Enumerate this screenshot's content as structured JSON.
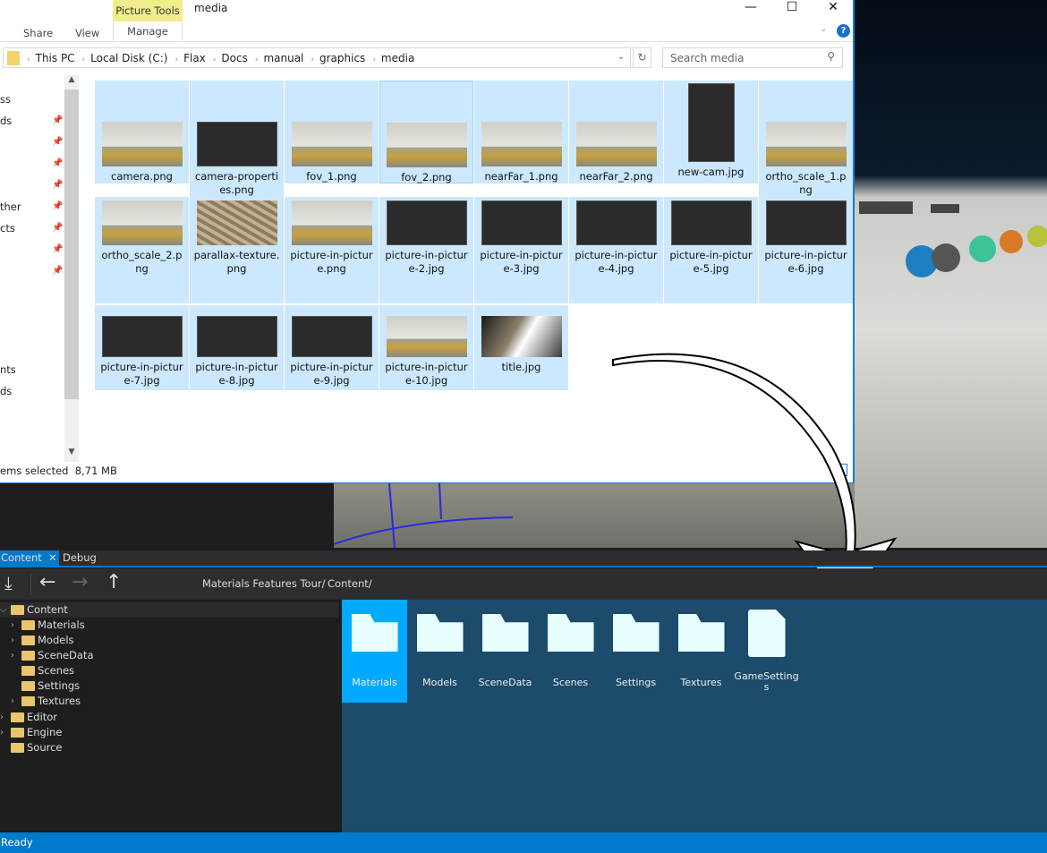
{
  "explorer": {
    "title": "media",
    "ribbon": {
      "share": "Share",
      "view": "View",
      "picture_tools": "Picture Tools",
      "manage": "Manage"
    },
    "window_controls": {
      "minimize": "—",
      "maximize": "☐",
      "close": "✕"
    },
    "breadcrumb": [
      "This PC",
      "Local Disk (C:)",
      "Flax",
      "Docs",
      "manual",
      "graphics",
      "media"
    ],
    "search_placeholder": "Search media",
    "nav_fragments": [
      "ss",
      "ds",
      "",
      "",
      "",
      "ther",
      "cts",
      "",
      "",
      "nts",
      "ds"
    ],
    "files": [
      {
        "name": "camera.png",
        "thumb": "light"
      },
      {
        "name": "camera-properties.png",
        "thumb": "dark"
      },
      {
        "name": "fov_1.png",
        "thumb": "light"
      },
      {
        "name": "fov_2.png",
        "thumb": "light"
      },
      {
        "name": "nearFar_1.png",
        "thumb": "light"
      },
      {
        "name": "nearFar_2.png",
        "thumb": "light"
      },
      {
        "name": "new-cam.jpg",
        "thumb": "dark"
      },
      {
        "name": "ortho_scale_1.png",
        "thumb": "light"
      },
      {
        "name": "ortho_scale_2.png",
        "thumb": "light"
      },
      {
        "name": "parallax-texture.png",
        "thumb": "texture"
      },
      {
        "name": "picture-in-picture.png",
        "thumb": "light"
      },
      {
        "name": "picture-in-picture-2.jpg",
        "thumb": "dark"
      },
      {
        "name": "picture-in-picture-3.jpg",
        "thumb": "dark"
      },
      {
        "name": "picture-in-picture-4.jpg",
        "thumb": "dark"
      },
      {
        "name": "picture-in-picture-5.jpg",
        "thumb": "dark"
      },
      {
        "name": "picture-in-picture-6.jpg",
        "thumb": "dark"
      },
      {
        "name": "picture-in-picture-7.jpg",
        "thumb": "dark"
      },
      {
        "name": "picture-in-picture-8.jpg",
        "thumb": "dark"
      },
      {
        "name": "picture-in-picture-9.jpg",
        "thumb": "dark"
      },
      {
        "name": "picture-in-picture-10.jpg",
        "thumb": "light"
      },
      {
        "name": "title.jpg",
        "thumb": "photo"
      }
    ],
    "status": {
      "selected": "ems selected",
      "size": "8,71 MB"
    }
  },
  "editor": {
    "tabs": [
      "Content",
      "Debug"
    ],
    "toolbar_path": [
      "Materials Features Tour/",
      "Content/"
    ],
    "tree": [
      {
        "label": "Content",
        "level": 0,
        "expanded": true
      },
      {
        "label": "Materials",
        "level": 1,
        "chevron": true
      },
      {
        "label": "Models",
        "level": 1,
        "chevron": true
      },
      {
        "label": "SceneData",
        "level": 1,
        "chevron": true
      },
      {
        "label": "Scenes",
        "level": 1,
        "chevron": false
      },
      {
        "label": "Settings",
        "level": 1,
        "chevron": false
      },
      {
        "label": "Textures",
        "level": 1,
        "chevron": true
      },
      {
        "label": "Editor",
        "level": 0,
        "chevron": true
      },
      {
        "label": "Engine",
        "level": 0,
        "chevron": true
      },
      {
        "label": "Source",
        "level": 0,
        "chevron": false
      }
    ],
    "items": [
      {
        "label": "Materials",
        "type": "folder",
        "selected": true
      },
      {
        "label": "Models",
        "type": "folder"
      },
      {
        "label": "SceneData",
        "type": "folder"
      },
      {
        "label": "Scenes",
        "type": "folder"
      },
      {
        "label": "Settings",
        "type": "folder"
      },
      {
        "label": "Textures",
        "type": "folder"
      },
      {
        "label": "GameSettings",
        "type": "file"
      }
    ],
    "status": "Ready",
    "accent": "#007acc"
  }
}
